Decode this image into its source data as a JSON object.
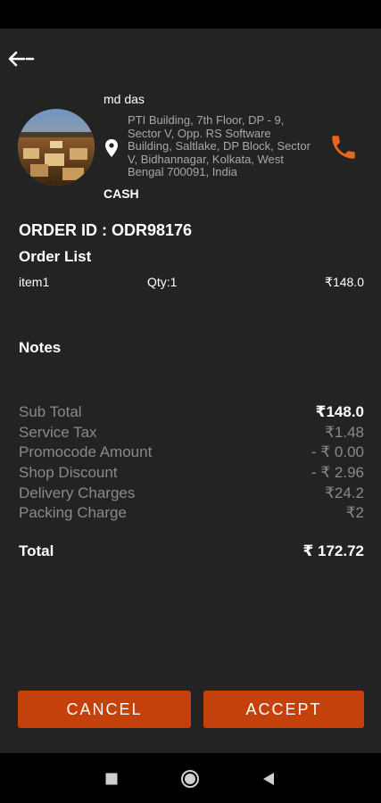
{
  "header": {
    "back_icon": "arrow-left-icon"
  },
  "customer": {
    "name": "md das",
    "address": "PTI Building, 7th Floor, DP - 9, Sector V, Opp. RS Software Building, Saltlake, DP Block, Sector V, Bidhannagar, Kolkata, West Bengal 700091, India",
    "payment_method": "CASH",
    "location_icon": "location-pin-icon",
    "phone_icon": "phone-icon"
  },
  "order": {
    "id_label": "ORDER ID : ODR98176",
    "list_title": "Order List",
    "items": [
      {
        "name": "item1",
        "qty": "Qty:1",
        "price": "₹148.0"
      }
    ]
  },
  "notes": {
    "title": "Notes"
  },
  "summary": [
    {
      "label": "Sub Total",
      "value": "₹148.0"
    },
    {
      "label": "Service Tax",
      "value": "₹1.48"
    },
    {
      "label": "Promocode Amount",
      "value": "- ₹ 0.00"
    },
    {
      "label": "Shop Discount",
      "value": "- ₹ 2.96"
    },
    {
      "label": "Delivery Charges",
      "value": "₹24.2"
    },
    {
      "label": "Packing Charge",
      "value": "₹2"
    }
  ],
  "total": {
    "label": "Total",
    "value": "₹ 172.72"
  },
  "actions": {
    "cancel_label": "CANCEL",
    "accept_label": "ACCEPT"
  },
  "colors": {
    "accent": "#c5410c",
    "phone": "#e8651d",
    "background": "#232323",
    "muted_text": "#8a8a8a"
  },
  "system_nav": {
    "recents_icon": "square-icon",
    "home_icon": "circle-icon",
    "back_icon": "triangle-back-icon"
  }
}
